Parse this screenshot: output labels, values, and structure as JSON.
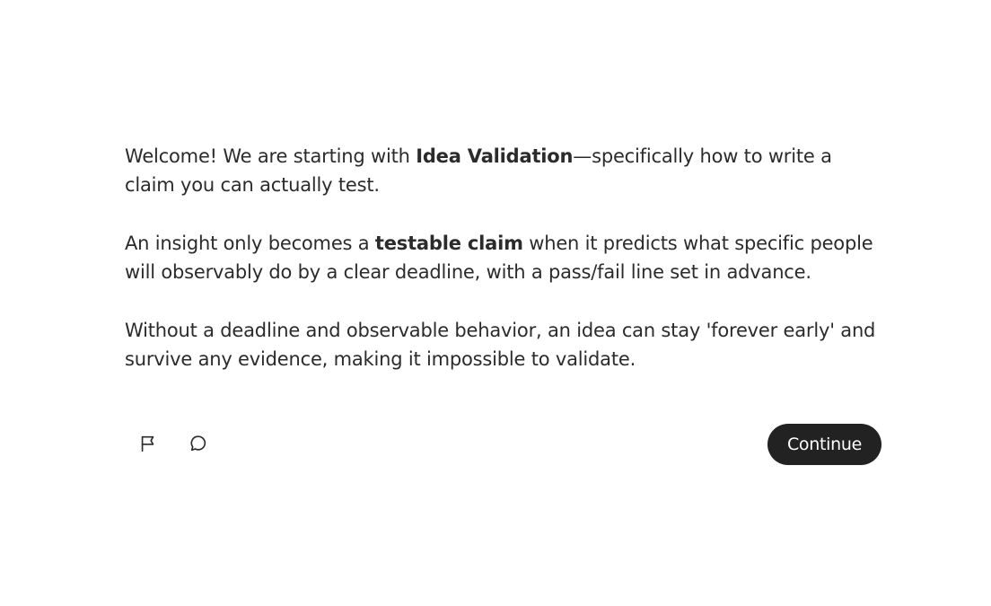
{
  "lesson": {
    "p1": {
      "before": "Welcome! We are starting with ",
      "bold": "Idea Validation",
      "after": "—specifically how to write a claim you can actually test."
    },
    "p2": {
      "before": "An insight only becomes a ",
      "bold": "testable claim",
      "after": " when it predicts what specific people will observably do by a clear deadline, with a pass/fail line set in advance."
    },
    "p3": {
      "text": "Without a deadline and observable behavior, an idea can stay 'forever early' and survive any evidence, making it impossible to validate."
    }
  },
  "actions": {
    "flag_icon": "flag-icon",
    "comment_icon": "comment-icon",
    "continue_label": "Continue"
  },
  "colors": {
    "text": "#2b2b2b",
    "button_bg": "#222222",
    "button_text": "#ffffff",
    "background": "#ffffff"
  }
}
